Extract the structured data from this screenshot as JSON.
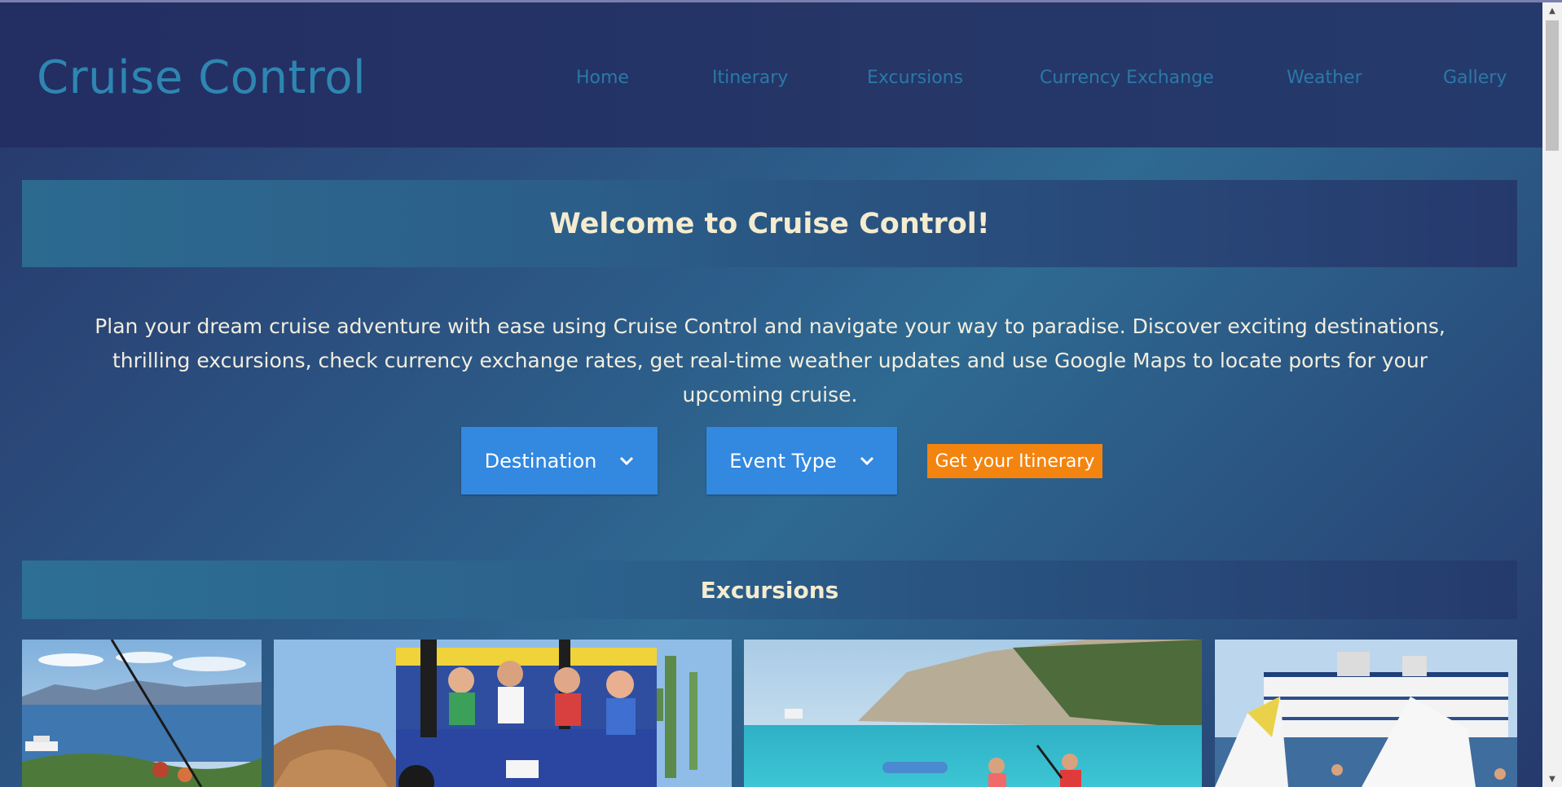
{
  "header": {
    "logo": "Cruise Control",
    "nav": [
      "Home",
      "Itinerary",
      "Excursions",
      "Currency Exchange",
      "Weather",
      "Gallery"
    ]
  },
  "welcome": {
    "title": "Welcome to Cruise Control!",
    "intro": "Plan your dream cruise adventure with ease using Cruise Control and navigate your way to paradise. Discover exciting destinations, thrilling excursions, check currency exchange rates, get real-time weather updates and use Google Maps to locate ports for your upcoming cruise."
  },
  "controls": {
    "destination_label": "Destination",
    "event_type_label": "Event Type",
    "cta_label": "Get your Itinerary"
  },
  "excursions": {
    "title": "Excursions",
    "photos": [
      "zipline-coast-photo",
      "jeep-safari-photo",
      "kayak-cove-photo",
      "water-park-ship-photo"
    ]
  },
  "colors": {
    "accent_blue": "#3388e0",
    "cta_orange": "#f3840f",
    "heading_cream": "#f4ecd0",
    "nav_link": "#2a79a8"
  }
}
